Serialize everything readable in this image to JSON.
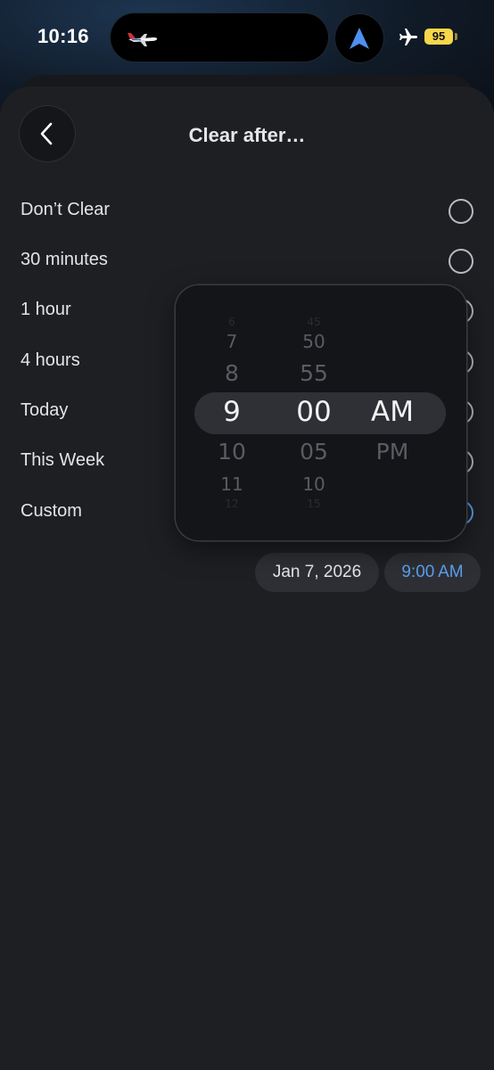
{
  "status_bar": {
    "time": "10:16",
    "battery": "95",
    "icons": [
      "airline-live-activity-icon",
      "location-arrow-icon",
      "airplane-mode-icon",
      "battery-icon"
    ]
  },
  "header": {
    "title": "Clear after…",
    "back_icon": "chevron-left-icon"
  },
  "options": [
    {
      "label": "Don’t Clear",
      "selected": false
    },
    {
      "label": "30 minutes",
      "selected": false
    },
    {
      "label": "1 hour",
      "selected": false
    },
    {
      "label": "4 hours",
      "selected": false
    },
    {
      "label": "Today",
      "selected": false
    },
    {
      "label": "This Week",
      "selected": false
    },
    {
      "label": "Custom",
      "selected": true
    }
  ],
  "custom": {
    "date": "Jan 7, 2026",
    "time": "9:00 AM"
  },
  "time_picker": {
    "hours": [
      "6",
      "7",
      "8",
      "9",
      "10",
      "11",
      "12"
    ],
    "minutes": [
      "45",
      "50",
      "55",
      "00",
      "05",
      "10",
      "15"
    ],
    "periods": [
      "AM",
      "PM"
    ],
    "selected_hour": "9",
    "selected_minute": "00",
    "selected_period": "AM"
  },
  "colors": {
    "accent": "#5aa0f0",
    "background": "#1e1f23",
    "battery": "#f7d64a"
  }
}
